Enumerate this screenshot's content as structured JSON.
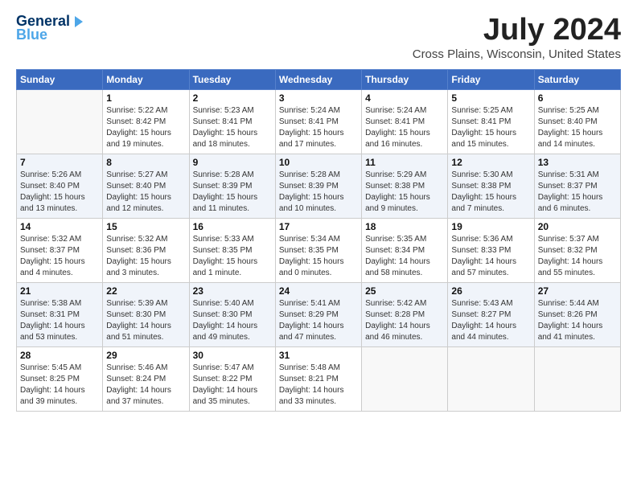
{
  "logo": {
    "line1": "General",
    "line2": "Blue"
  },
  "title": "July 2024",
  "subtitle": "Cross Plains, Wisconsin, United States",
  "headers": [
    "Sunday",
    "Monday",
    "Tuesday",
    "Wednesday",
    "Thursday",
    "Friday",
    "Saturday"
  ],
  "weeks": [
    [
      {
        "day": "",
        "detail": ""
      },
      {
        "day": "1",
        "detail": "Sunrise: 5:22 AM\nSunset: 8:42 PM\nDaylight: 15 hours\nand 19 minutes."
      },
      {
        "day": "2",
        "detail": "Sunrise: 5:23 AM\nSunset: 8:41 PM\nDaylight: 15 hours\nand 18 minutes."
      },
      {
        "day": "3",
        "detail": "Sunrise: 5:24 AM\nSunset: 8:41 PM\nDaylight: 15 hours\nand 17 minutes."
      },
      {
        "day": "4",
        "detail": "Sunrise: 5:24 AM\nSunset: 8:41 PM\nDaylight: 15 hours\nand 16 minutes."
      },
      {
        "day": "5",
        "detail": "Sunrise: 5:25 AM\nSunset: 8:41 PM\nDaylight: 15 hours\nand 15 minutes."
      },
      {
        "day": "6",
        "detail": "Sunrise: 5:25 AM\nSunset: 8:40 PM\nDaylight: 15 hours\nand 14 minutes."
      }
    ],
    [
      {
        "day": "7",
        "detail": "Sunrise: 5:26 AM\nSunset: 8:40 PM\nDaylight: 15 hours\nand 13 minutes."
      },
      {
        "day": "8",
        "detail": "Sunrise: 5:27 AM\nSunset: 8:40 PM\nDaylight: 15 hours\nand 12 minutes."
      },
      {
        "day": "9",
        "detail": "Sunrise: 5:28 AM\nSunset: 8:39 PM\nDaylight: 15 hours\nand 11 minutes."
      },
      {
        "day": "10",
        "detail": "Sunrise: 5:28 AM\nSunset: 8:39 PM\nDaylight: 15 hours\nand 10 minutes."
      },
      {
        "day": "11",
        "detail": "Sunrise: 5:29 AM\nSunset: 8:38 PM\nDaylight: 15 hours\nand 9 minutes."
      },
      {
        "day": "12",
        "detail": "Sunrise: 5:30 AM\nSunset: 8:38 PM\nDaylight: 15 hours\nand 7 minutes."
      },
      {
        "day": "13",
        "detail": "Sunrise: 5:31 AM\nSunset: 8:37 PM\nDaylight: 15 hours\nand 6 minutes."
      }
    ],
    [
      {
        "day": "14",
        "detail": "Sunrise: 5:32 AM\nSunset: 8:37 PM\nDaylight: 15 hours\nand 4 minutes."
      },
      {
        "day": "15",
        "detail": "Sunrise: 5:32 AM\nSunset: 8:36 PM\nDaylight: 15 hours\nand 3 minutes."
      },
      {
        "day": "16",
        "detail": "Sunrise: 5:33 AM\nSunset: 8:35 PM\nDaylight: 15 hours\nand 1 minute."
      },
      {
        "day": "17",
        "detail": "Sunrise: 5:34 AM\nSunset: 8:35 PM\nDaylight: 15 hours\nand 0 minutes."
      },
      {
        "day": "18",
        "detail": "Sunrise: 5:35 AM\nSunset: 8:34 PM\nDaylight: 14 hours\nand 58 minutes."
      },
      {
        "day": "19",
        "detail": "Sunrise: 5:36 AM\nSunset: 8:33 PM\nDaylight: 14 hours\nand 57 minutes."
      },
      {
        "day": "20",
        "detail": "Sunrise: 5:37 AM\nSunset: 8:32 PM\nDaylight: 14 hours\nand 55 minutes."
      }
    ],
    [
      {
        "day": "21",
        "detail": "Sunrise: 5:38 AM\nSunset: 8:31 PM\nDaylight: 14 hours\nand 53 minutes."
      },
      {
        "day": "22",
        "detail": "Sunrise: 5:39 AM\nSunset: 8:30 PM\nDaylight: 14 hours\nand 51 minutes."
      },
      {
        "day": "23",
        "detail": "Sunrise: 5:40 AM\nSunset: 8:30 PM\nDaylight: 14 hours\nand 49 minutes."
      },
      {
        "day": "24",
        "detail": "Sunrise: 5:41 AM\nSunset: 8:29 PM\nDaylight: 14 hours\nand 47 minutes."
      },
      {
        "day": "25",
        "detail": "Sunrise: 5:42 AM\nSunset: 8:28 PM\nDaylight: 14 hours\nand 46 minutes."
      },
      {
        "day": "26",
        "detail": "Sunrise: 5:43 AM\nSunset: 8:27 PM\nDaylight: 14 hours\nand 44 minutes."
      },
      {
        "day": "27",
        "detail": "Sunrise: 5:44 AM\nSunset: 8:26 PM\nDaylight: 14 hours\nand 41 minutes."
      }
    ],
    [
      {
        "day": "28",
        "detail": "Sunrise: 5:45 AM\nSunset: 8:25 PM\nDaylight: 14 hours\nand 39 minutes."
      },
      {
        "day": "29",
        "detail": "Sunrise: 5:46 AM\nSunset: 8:24 PM\nDaylight: 14 hours\nand 37 minutes."
      },
      {
        "day": "30",
        "detail": "Sunrise: 5:47 AM\nSunset: 8:22 PM\nDaylight: 14 hours\nand 35 minutes."
      },
      {
        "day": "31",
        "detail": "Sunrise: 5:48 AM\nSunset: 8:21 PM\nDaylight: 14 hours\nand 33 minutes."
      },
      {
        "day": "",
        "detail": ""
      },
      {
        "day": "",
        "detail": ""
      },
      {
        "day": "",
        "detail": ""
      }
    ]
  ]
}
